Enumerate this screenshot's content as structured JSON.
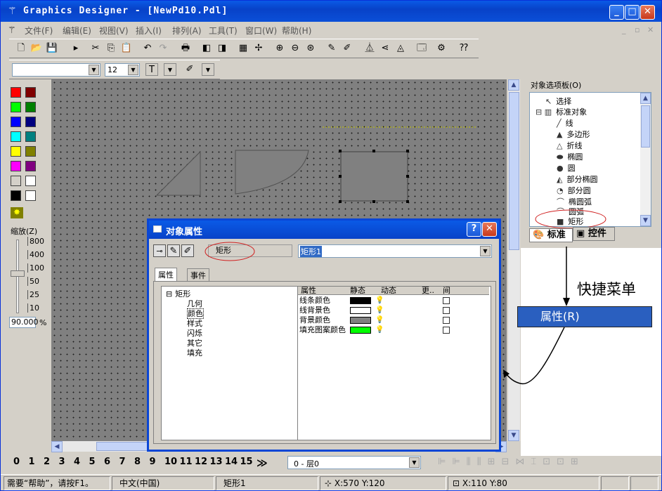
{
  "window": {
    "title": "Graphics Designer - [NewPd10.Pdl]"
  },
  "menu": [
    "文件(F)",
    "编辑(E)",
    "视图(V)",
    "插入(I)",
    "排列(A)",
    "工具(T)",
    "窗口(W)",
    "帮助(H)"
  ],
  "format": {
    "font": "",
    "size": "12"
  },
  "palette": [
    "#ff0000",
    "#800000",
    "#00ff00",
    "#008000",
    "#0000ff",
    "#000080",
    "#00ffff",
    "#008080",
    "#ffff00",
    "#808000",
    "#ff00ff",
    "#800080",
    "#d4d0c8",
    "#ffffff",
    "#000000",
    "#ffffff"
  ],
  "zoom": {
    "label": "缩放(Z)",
    "ticks": [
      "800",
      "400",
      "100",
      "50",
      "25",
      "10"
    ],
    "value": "90.000",
    "unit": "%"
  },
  "object_panel": {
    "title": "对象选项板(O)",
    "items": [
      "选择",
      "标准对象",
      "线",
      "多边形",
      "折线",
      "椭圆",
      "圆",
      "部分椭圆",
      "部分圆",
      "椭圆弧",
      "圆弧",
      "矩形"
    ],
    "tabs": [
      "标准",
      "控件"
    ]
  },
  "annotation": {
    "shortcut_label": "快捷菜单",
    "menu_item": "属性(R)"
  },
  "dialog": {
    "title": "对象属性",
    "help": "?",
    "type_label": "矩形",
    "object_name": "矩形1",
    "tabs": [
      "属性",
      "事件"
    ],
    "tree": [
      "矩形",
      "几何",
      "颜色",
      "样式",
      "闪烁",
      "其它",
      "填充"
    ],
    "columns": [
      "属性",
      "静态",
      "动态",
      "更..",
      "间"
    ],
    "rows": [
      {
        "name": "线条颜色",
        "color": "#000000"
      },
      {
        "name": "线背景色",
        "color": "#ffffff"
      },
      {
        "name": "背景颜色",
        "color": "#808080"
      },
      {
        "name": "填充图案颜色",
        "color": "#00ff00"
      }
    ]
  },
  "layers": {
    "numbers": [
      "0",
      "1",
      "2",
      "3",
      "4",
      "5",
      "6",
      "7",
      "8",
      "9",
      "10",
      "11",
      "12",
      "13",
      "14",
      "15"
    ],
    "more": "≫",
    "current": "0 - 层0"
  },
  "status": {
    "help": "需要“帮助”，请按F1。",
    "lang": "中文(中国)",
    "object": "矩形1",
    "pos": "X:570 Y:120",
    "size": "X:110 Y:80"
  }
}
